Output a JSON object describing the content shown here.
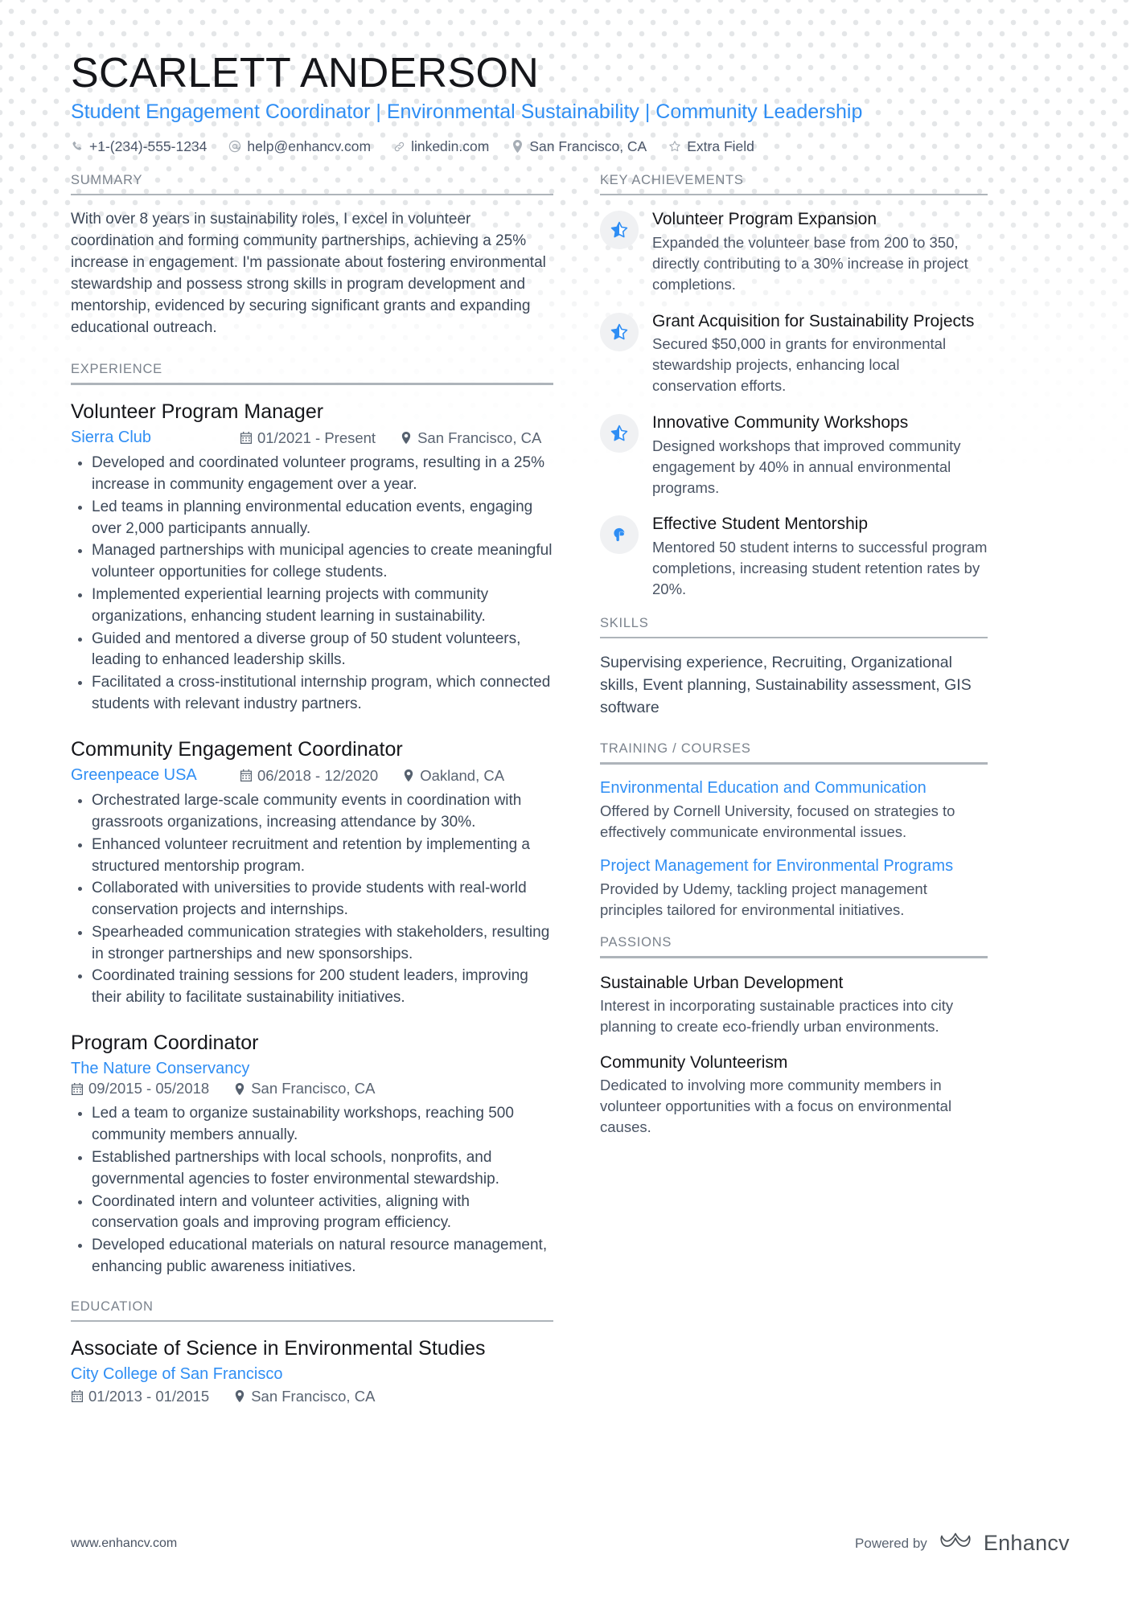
{
  "header": {
    "full_name": "SCARLETT ANDERSON",
    "headline": "Student Engagement Coordinator | Environmental Sustainability | Community Leadership",
    "contacts": [
      {
        "icon": "phone-icon",
        "text": "+1-(234)-555-1234"
      },
      {
        "icon": "email-icon",
        "text": "help@enhancv.com"
      },
      {
        "icon": "link-icon",
        "text": "linkedin.com"
      },
      {
        "icon": "location-icon",
        "text": "San Francisco, CA"
      },
      {
        "icon": "star-icon",
        "text": "Extra Field"
      }
    ]
  },
  "summary": {
    "title": "SUMMARY",
    "text": "With over 8 years in sustainability roles, I excel in volunteer coordination and forming community partnerships, achieving a 25% increase in engagement. I'm passionate about fostering environmental stewardship and possess strong skills in program development and mentorship, evidenced by securing significant grants and expanding educational outreach."
  },
  "experience": {
    "title": "EXPERIENCE",
    "jobs": [
      {
        "title": "Volunteer Program Manager",
        "company": "Sierra Club",
        "dates": "01/2021 - Present",
        "location": "San Francisco, CA",
        "meta_inline": true,
        "bullets": [
          "Developed and coordinated volunteer programs, resulting in a 25% increase in community engagement over a year.",
          "Led teams in planning environmental education events, engaging over 2,000 participants annually.",
          "Managed partnerships with municipal agencies to create meaningful volunteer opportunities for college students.",
          "Implemented experiential learning projects with community organizations, enhancing student learning in sustainability.",
          "Guided and mentored a diverse group of 50 student volunteers, leading to enhanced leadership skills.",
          "Facilitated a cross-institutional internship program, which connected students with relevant industry partners."
        ]
      },
      {
        "title": "Community Engagement Coordinator",
        "company": "Greenpeace USA",
        "dates": "06/2018 - 12/2020",
        "location": "Oakland, CA",
        "meta_inline": true,
        "bullets": [
          "Orchestrated large-scale community events in coordination with grassroots organizations, increasing attendance by 30%.",
          "Enhanced volunteer recruitment and retention by implementing a structured mentorship program.",
          "Collaborated with universities to provide students with real-world conservation projects and internships.",
          "Spearheaded communication strategies with stakeholders, resulting in stronger partnerships and new sponsorships.",
          "Coordinated training sessions for 200 student leaders, improving their ability to facilitate sustainability initiatives."
        ]
      },
      {
        "title": "Program Coordinator",
        "company": "The Nature Conservancy",
        "dates": "09/2015 - 05/2018",
        "location": "San Francisco, CA",
        "meta_inline": false,
        "bullets": [
          "Led a team to organize sustainability workshops, reaching 500 community members annually.",
          "Established partnerships with local schools, nonprofits, and governmental agencies to foster environmental stewardship.",
          "Coordinated intern and volunteer activities, aligning with conservation goals and improving program efficiency.",
          "Developed educational materials on natural resource management, enhancing public awareness initiatives."
        ]
      }
    ]
  },
  "education": {
    "title": "EDUCATION",
    "entries": [
      {
        "degree": "Associate of Science in Environmental Studies",
        "school": "City College of San Francisco",
        "dates": "01/2013 - 01/2015",
        "location": "San Francisco, CA"
      }
    ]
  },
  "key_achievements": {
    "title": "KEY ACHIEVEMENTS",
    "items": [
      {
        "icon": "star-badge-icon",
        "title": "Volunteer Program Expansion",
        "description": "Expanded the volunteer base from 200 to 350, directly contributing to a 30% increase in project completions."
      },
      {
        "icon": "star-badge-icon",
        "title": "Grant Acquisition for Sustainability Projects",
        "description": "Secured $50,000 in grants for environmental stewardship projects, enhancing local conservation efforts."
      },
      {
        "icon": "star-badge-icon",
        "title": "Innovative Community Workshops",
        "description": "Designed workshops that improved community engagement by 40% in annual environmental programs."
      },
      {
        "icon": "mentorship-badge-icon",
        "title": "Effective Student Mentorship",
        "description": "Mentored 50 student interns to successful program completions, increasing student retention rates by 20%."
      }
    ]
  },
  "skills": {
    "title": "SKILLS",
    "text": "Supervising experience, Recruiting, Organizational skills, Event planning, Sustainability assessment, GIS software"
  },
  "training": {
    "title": "TRAINING / COURSES",
    "courses": [
      {
        "title": "Environmental Education and Communication",
        "description": "Offered by Cornell University, focused on strategies to effectively communicate environmental issues."
      },
      {
        "title": "Project Management for Environmental Programs",
        "description": "Provided by Udemy, tackling project management principles tailored for environmental initiatives."
      }
    ]
  },
  "passions": {
    "title": "PASSIONS",
    "items": [
      {
        "title": "Sustainable Urban Development",
        "description": "Interest in incorporating sustainable practices into city planning to create eco-friendly urban environments."
      },
      {
        "title": "Community Volunteerism",
        "description": "Dedicated to involving more community members in volunteer opportunities with a focus on environmental causes."
      }
    ]
  },
  "footer": {
    "url": "www.enhancv.com",
    "powered_by": "Powered by",
    "brand": "Enhancv"
  },
  "colors": {
    "accent_blue": "#2f8ef4",
    "heading_gray": "#7b838d",
    "body_text": "#3c4858",
    "rule_gray": "#aeb4ba",
    "badge_bg": "#f0f1f3"
  }
}
